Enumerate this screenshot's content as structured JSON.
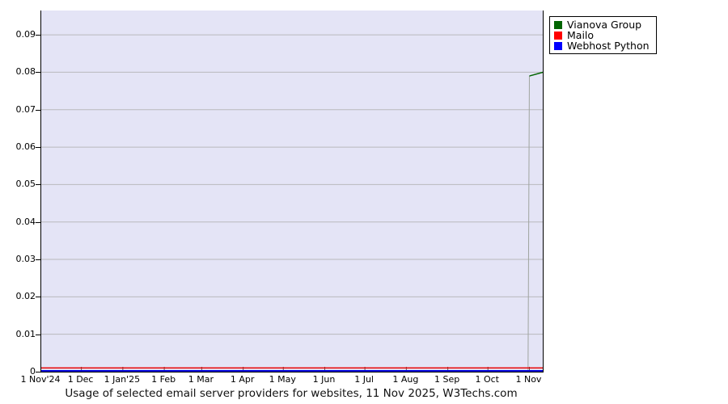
{
  "colors": {
    "plot_background": "#e4e4f6",
    "gridline": "#b8b8bc",
    "axis": "#000000",
    "tick": "#555555",
    "legend_border": "#000000",
    "jump_connector": "#9fa49f"
  },
  "legend": {
    "position": "top-right",
    "entries": [
      {
        "label": "Vianova Group",
        "color": "#006400"
      },
      {
        "label": "Mailo",
        "color": "#ff0000"
      },
      {
        "label": "Webhost Python",
        "color": "#0000ff"
      }
    ]
  },
  "chart_data": {
    "type": "line",
    "title": "Usage of selected email server providers for websites, 11 Nov 2025, W3Techs.com",
    "grid": {
      "horizontal": true,
      "vertical": false
    },
    "x": {
      "description": "time axis, 1 Nov 2024 to 11 Nov 2025, measured in days from start",
      "domain_days": [
        0,
        375
      ],
      "ticks": [
        {
          "label": "1 Nov'24",
          "day": 0
        },
        {
          "label": "1 Dec",
          "day": 30
        },
        {
          "label": "1 Jan'25",
          "day": 61
        },
        {
          "label": "1 Feb",
          "day": 92
        },
        {
          "label": "1 Mar",
          "day": 120
        },
        {
          "label": "1 Apr",
          "day": 151
        },
        {
          "label": "1 May",
          "day": 181
        },
        {
          "label": "1 Jun",
          "day": 212
        },
        {
          "label": "1 Jul",
          "day": 242
        },
        {
          "label": "1 Aug",
          "day": 273
        },
        {
          "label": "1 Sep",
          "day": 304
        },
        {
          "label": "1 Oct",
          "day": 334
        },
        {
          "label": "1 Nov",
          "day": 365
        }
      ]
    },
    "y": {
      "render_max": 0.0965,
      "ticks": [
        {
          "label": "0",
          "value": 0
        },
        {
          "label": "0.01",
          "value": 0.01
        },
        {
          "label": "0.02",
          "value": 0.02
        },
        {
          "label": "0.03",
          "value": 0.03
        },
        {
          "label": "0.04",
          "value": 0.04
        },
        {
          "label": "0.05",
          "value": 0.05
        },
        {
          "label": "0.06",
          "value": 0.06
        },
        {
          "label": "0.07",
          "value": 0.07
        },
        {
          "label": "0.08",
          "value": 0.08
        },
        {
          "label": "0.09",
          "value": 0.09
        }
      ]
    },
    "series": [
      {
        "name": "Vianova Group",
        "color": "#006400",
        "width": 1.5,
        "points": [
          [
            0,
            0
          ],
          [
            364,
            0
          ],
          [
            365,
            0.079
          ],
          [
            375,
            0.08
          ]
        ],
        "note": "zero until 31 Oct 2025, jumps to 0.079 on 1 Nov 2025, rises to 0.080 by 11 Nov 2025"
      },
      {
        "name": "Mailo",
        "color": "#e80000",
        "width": 1.5,
        "points": [
          [
            0,
            0.001
          ],
          [
            375,
            0.001
          ]
        ],
        "note": "constant 0.001 for whole period"
      },
      {
        "name": "Webhost Python",
        "color": "#0000dd",
        "width": 2,
        "points": [
          [
            0,
            0
          ],
          [
            375,
            0
          ]
        ],
        "note": "constant 0 for whole period"
      }
    ]
  }
}
